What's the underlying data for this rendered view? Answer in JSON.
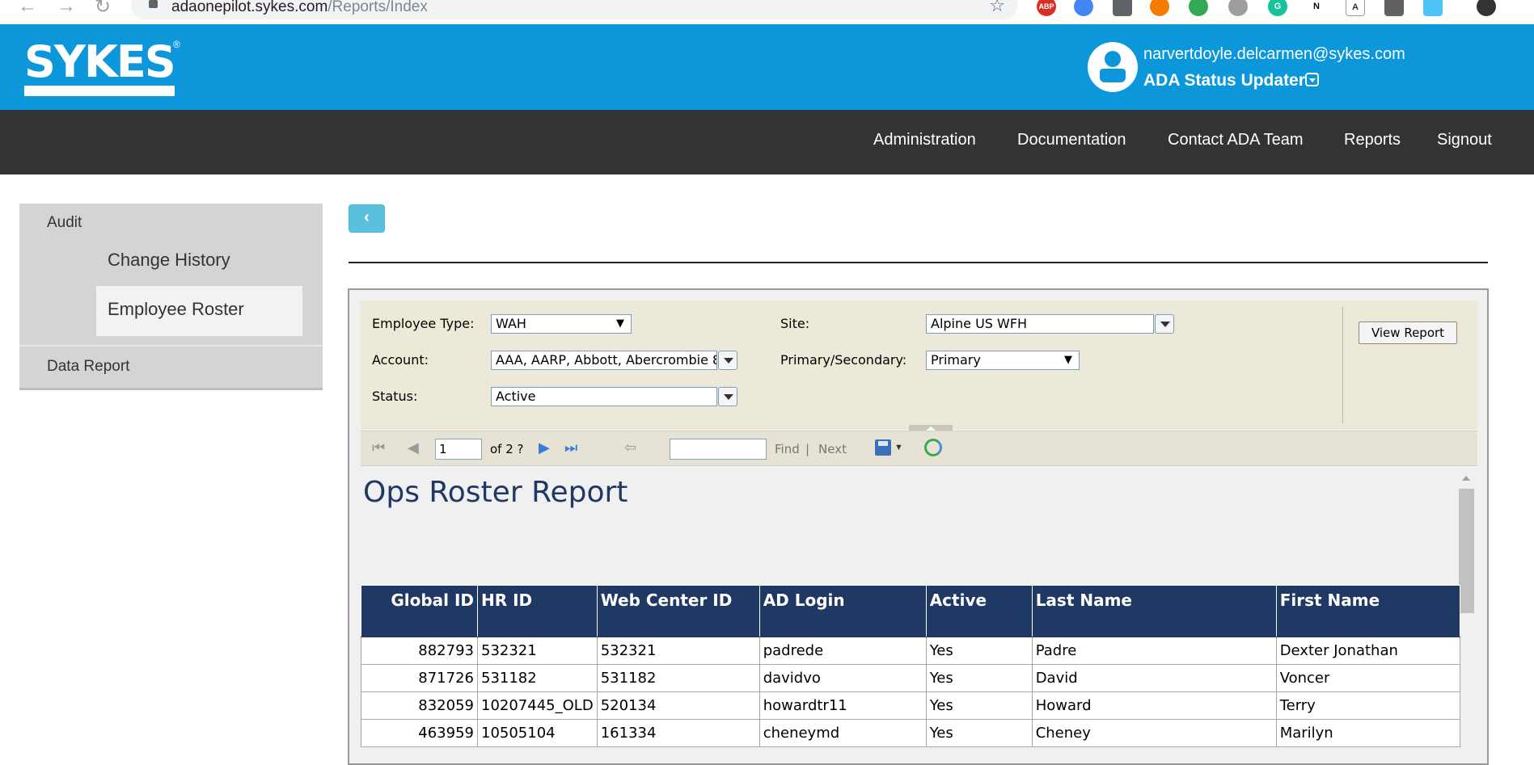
{
  "browser": {
    "url_domain": "adaonepilot.sykes.com",
    "url_path": "/Reports/Index",
    "extensions": [
      "ABP",
      "G",
      "N",
      "A"
    ]
  },
  "header": {
    "logo_text": "SYKES",
    "logo_mark": "®",
    "user_email": "narvertdoyle.delcarmen@sykes.com",
    "user_role": "ADA Status Updater"
  },
  "nav": {
    "items": [
      "Administration",
      "Documentation",
      "Contact ADA Team",
      "Reports",
      "Signout"
    ]
  },
  "sidebar": {
    "audit_label": "Audit",
    "change_history_label": "Change History",
    "employee_roster_label": "Employee Roster",
    "data_report_label": "Data Report"
  },
  "params": {
    "employee_type_label": "Employee Type:",
    "employee_type_value": "WAH",
    "account_label": "Account:",
    "account_value": "AAA, AARP, Abbott, Abercrombie 8",
    "status_label": "Status:",
    "status_value": "Active",
    "site_label": "Site:",
    "site_value": "Alpine US WFH",
    "primary_secondary_label": "Primary/Secondary:",
    "primary_secondary_value": "Primary",
    "view_report_label": "View Report"
  },
  "toolbar": {
    "page_value": "1",
    "page_of": "of 2 ?",
    "find_label": "Find",
    "separator": "|",
    "next_label": "Next"
  },
  "report": {
    "title": "Ops Roster Report",
    "columns": [
      "Global ID",
      "HR ID",
      "Web Center ID",
      "AD Login",
      "Active",
      "Last Name",
      "First Name"
    ],
    "rows": [
      [
        "882793",
        "532321",
        "532321",
        "padrede",
        "Yes",
        "Padre",
        "Dexter Jonathan"
      ],
      [
        "871726",
        "531182",
        "531182",
        "davidvo",
        "Yes",
        "David",
        "Voncer"
      ],
      [
        "832059",
        "10207445_OLD",
        "520134",
        "howardtr11",
        "Yes",
        "Howard",
        "Terry"
      ],
      [
        "463959",
        "10505104",
        "161334",
        "cheneymd",
        "Yes",
        "Cheney",
        "Marilyn"
      ]
    ]
  },
  "colors": {
    "header_blue": "#0b97d9",
    "nav_dark": "#333333",
    "table_header_navy": "#1f3864",
    "back_button": "#5bc0de"
  }
}
